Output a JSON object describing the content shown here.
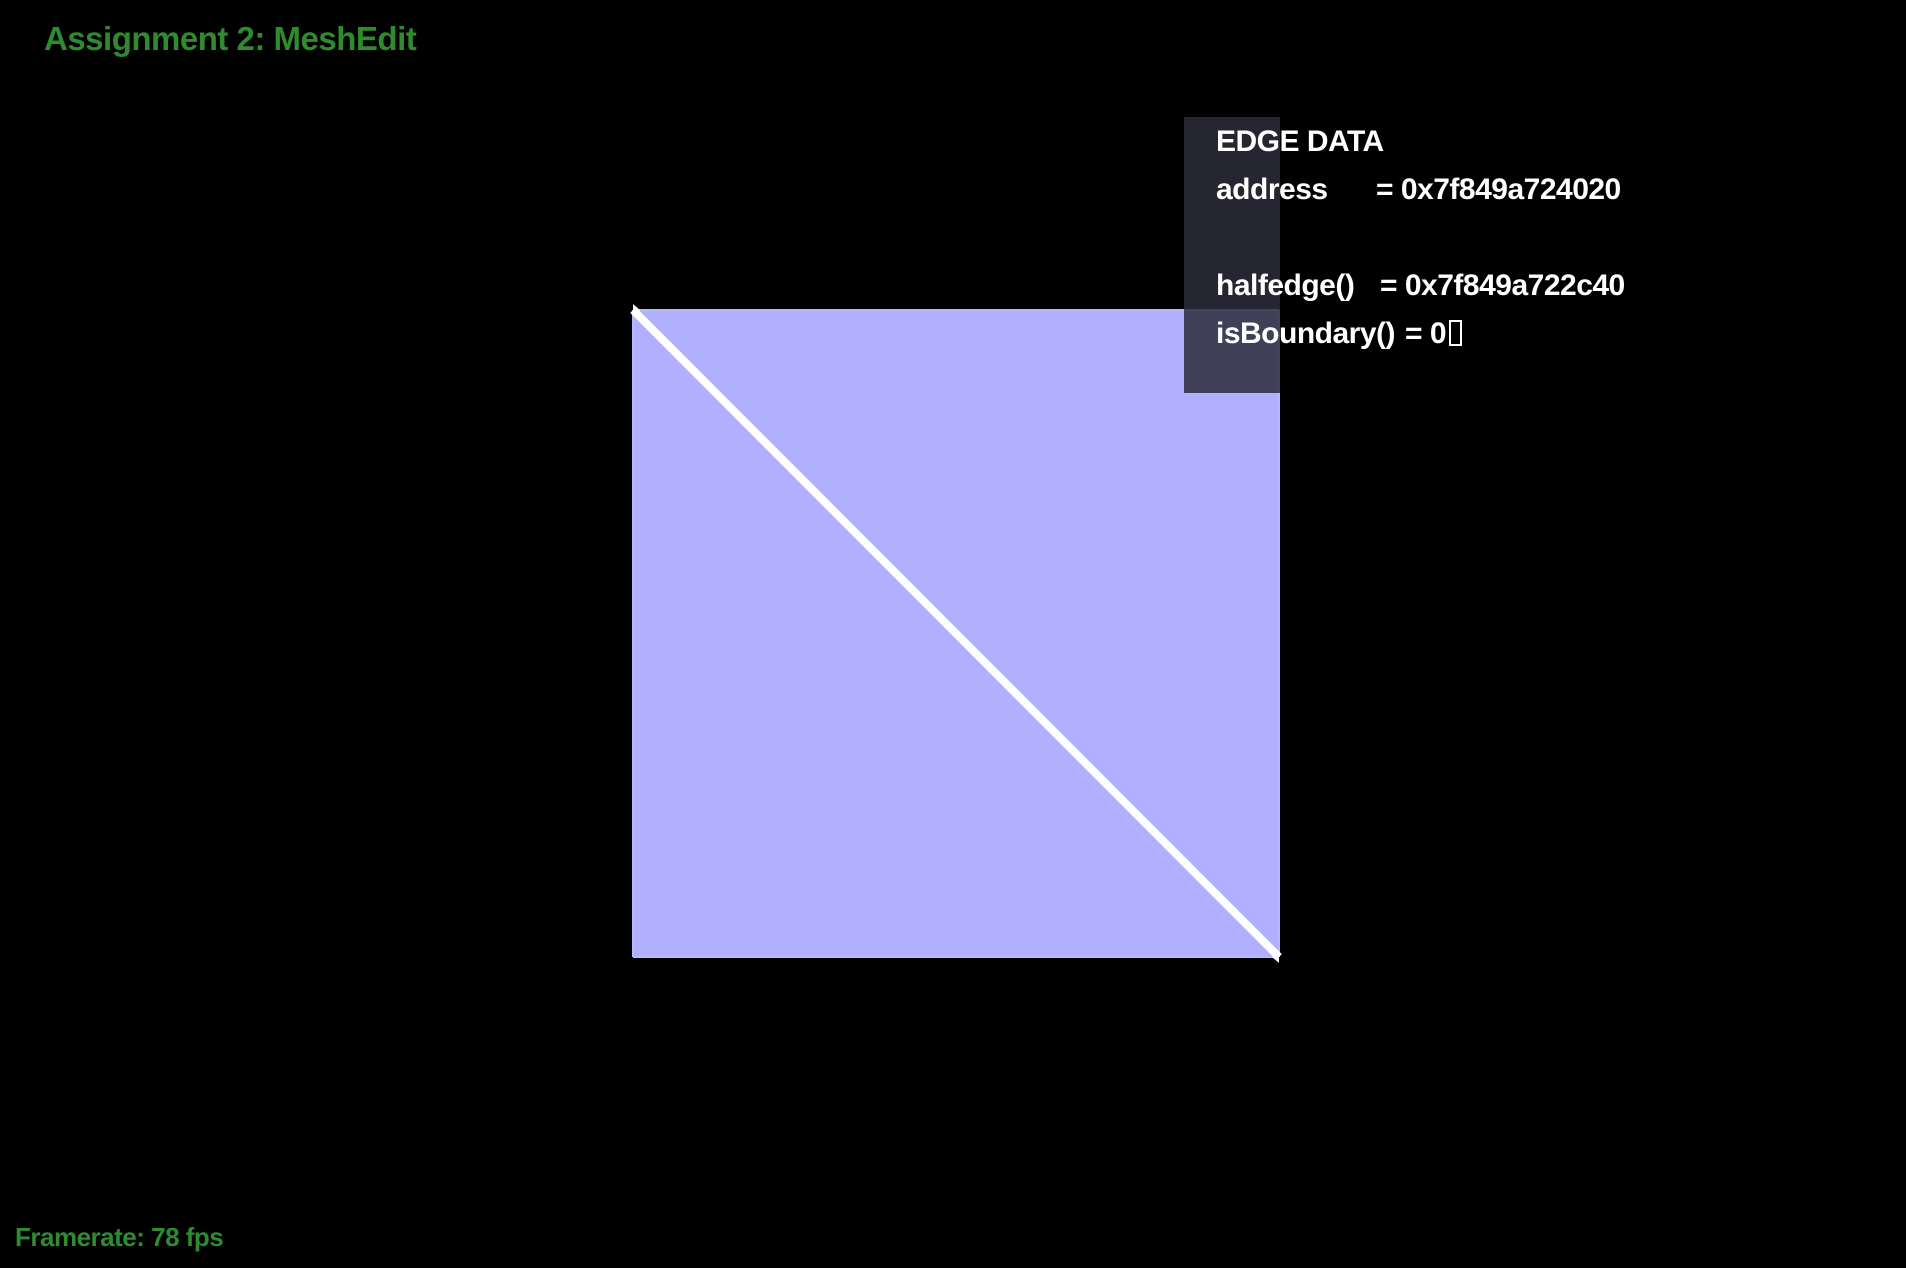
{
  "window": {
    "title": "Assignment 2: MeshEdit"
  },
  "status": {
    "framerate": "Framerate: 78 fps"
  },
  "colors": {
    "background": "#000000",
    "title_green": "#2e8b2e",
    "face_fill": "#b0b0fe",
    "selected_edge": "#ffffff",
    "panel_bg": "#2d2d3c"
  },
  "edge_info": {
    "header": "EDGE DATA",
    "rows": [
      {
        "key": "address",
        "value": "= 0x7f849a724020"
      },
      {
        "key": "halfedge()",
        "value": "= 0x7f849a722c40"
      },
      {
        "key": "isBoundary()",
        "value": "= 0"
      }
    ]
  }
}
